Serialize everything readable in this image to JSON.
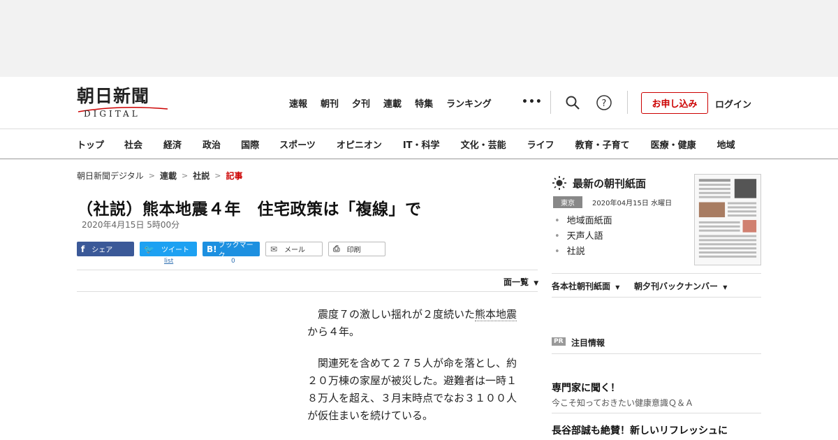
{
  "colors": {
    "brand_red": "#cc0000",
    "facebook": "#3b5998",
    "twitter": "#1da1f2",
    "hatena": "#1d90e0"
  },
  "header": {
    "logo_main": "朝日新聞",
    "logo_sub": "DIGITAL",
    "nav": [
      "速報",
      "朝刊",
      "夕刊",
      "連載",
      "特集",
      "ランキング"
    ],
    "more": "•••",
    "search_icon": "search-icon",
    "help_icon": "help-icon",
    "subscribe": "お申し込み",
    "login": "ログイン"
  },
  "categories": [
    "トップ",
    "社会",
    "経済",
    "政治",
    "国際",
    "スポーツ",
    "オピニオン",
    "IT・科学",
    "文化・芸能",
    "ライフ",
    "教育・子育て",
    "医療・健康",
    "地域"
  ],
  "breadcrumb": [
    "朝日新聞デジタル",
    "連載",
    "社説",
    "記事"
  ],
  "article": {
    "title": "（社説）熊本地震４年　住宅政策は「複線」で",
    "date": "2020年4月15日 5時00分",
    "share": {
      "facebook": "シェア",
      "twitter": "ツイート",
      "hatena": "ブックマーク",
      "mail": "メール",
      "print": "印刷",
      "twitter_count": "list",
      "hatena_count": "0"
    },
    "menu_toggle": "面一覧",
    "p1_before": "震度７の激しい揺れが２度続いた",
    "p1_link": "熊本地震",
    "p1_after": "から４年。",
    "p2": "関連死を含めて２７５人が命を落とし、約２０万棟の家屋が被災した。避難者は一時１８万人を超え、３月末時点でなお３１００人が仮住まいを続けている。"
  },
  "sidebar": {
    "title": "最新の朝刊紙面",
    "edition": "東京",
    "edition_date": "2020年04月15日 水曜日",
    "links": [
      "地域面紙面",
      "天声人語",
      "社説"
    ],
    "dropdown1": "各本社朝刊紙面",
    "dropdown2": "朝夕刊バックナンバー",
    "pr_badge": "PR",
    "pr_title": "注目情報",
    "promo1_head": "専門家に聞く！",
    "promo1_sub": "今こそ知っておきたい健康意識Ｑ＆Ａ",
    "promo2_head": "長谷部誠も絶賛！新しいリフレッシュに"
  }
}
